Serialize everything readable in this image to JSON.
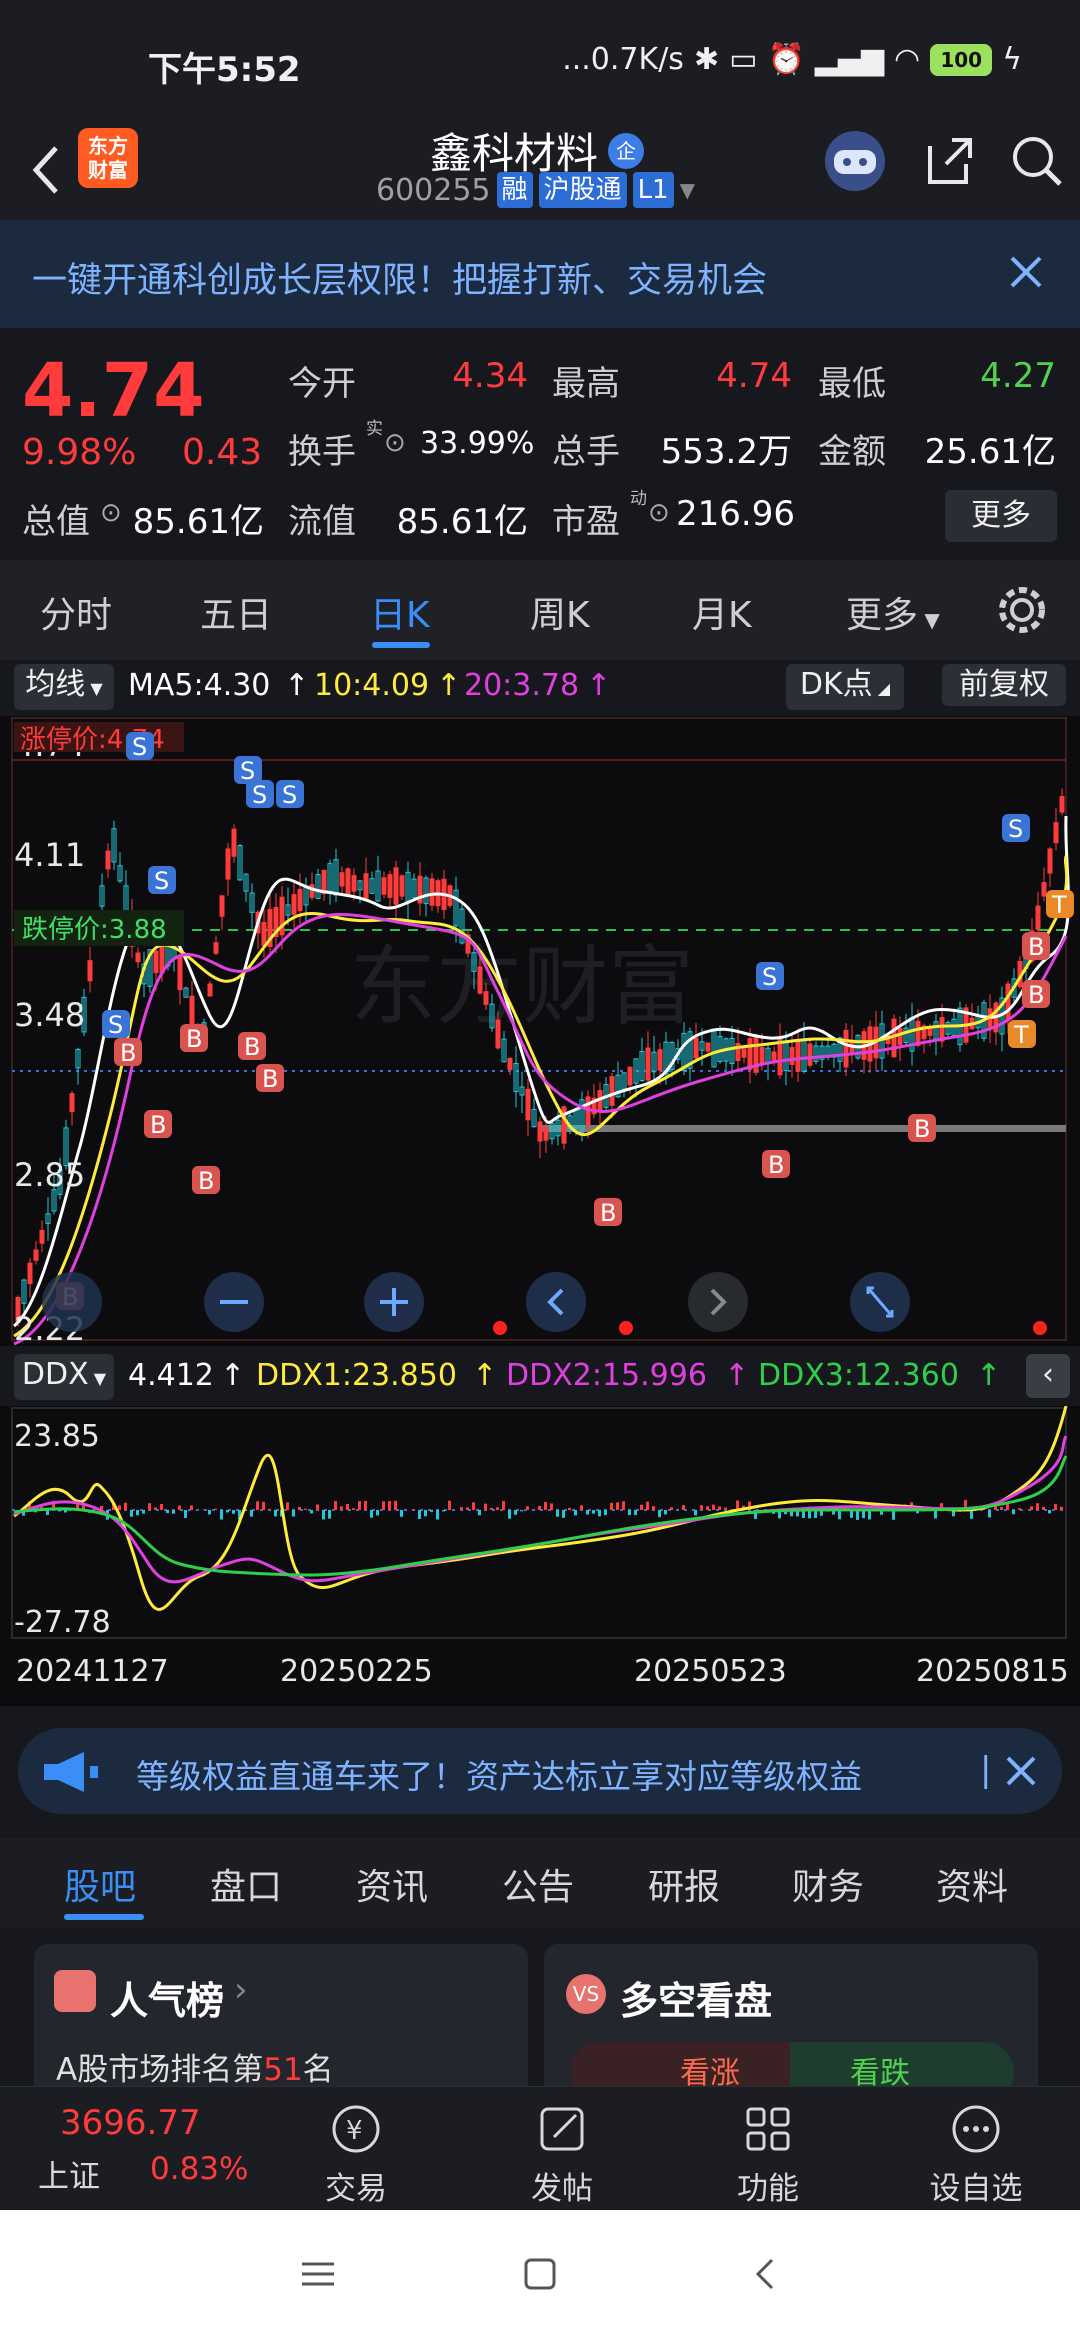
{
  "status": {
    "time": "下午5:52",
    "net": "...0.7K/s",
    "battery": "100"
  },
  "header": {
    "stock_name": "鑫科材料",
    "qi": "企",
    "code": "600255",
    "tags": [
      "融",
      "沪股通",
      "L1"
    ]
  },
  "banner": {
    "text": "一键开通科创成长层权限！把握打新、交易机会"
  },
  "quote": {
    "price": "4.74",
    "pct": "9.98%",
    "chg": "0.43",
    "labels": {
      "open": "今开",
      "high": "最高",
      "low": "最低",
      "turnover": "换手",
      "volume": "总手",
      "amount": "金额",
      "mktcap": "总值",
      "float": "流值",
      "pe": "市盈"
    },
    "values": {
      "open": "4.34",
      "high": "4.74",
      "low": "4.27",
      "turnover": "33.99%",
      "volume": "553.2万",
      "amount": "25.61亿",
      "mktcap": "85.61亿",
      "float": "85.61亿",
      "pe": "216.96"
    },
    "sup_turnover": "实",
    "sup_pe": "动",
    "more": "更多"
  },
  "tabs": [
    "分时",
    "五日",
    "日K",
    "周K",
    "月K",
    "更多"
  ],
  "ma": {
    "selector": "均线",
    "ma5": "MA5:4.30",
    "ma10": "10:4.09",
    "ma20": "20:3.78",
    "dk": "DK点",
    "adjust": "前复权"
  },
  "colors": {
    "up": "#ff3b3b",
    "down": "#20c8d8",
    "ma5": "#ffffff",
    "ma10": "#ffeb3b",
    "ma20": "#e040e0",
    "accent": "#3a8ef6"
  },
  "kchart": {
    "ticks": [
      "4.74",
      "4.11",
      "3.48",
      "2.85",
      "2.22"
    ],
    "limit_up": "涨停价:4.74",
    "limit_down": "跌停价:3.88",
    "watermark": "东方财富",
    "markers_s": [
      "S",
      "S",
      "S",
      "S",
      "S",
      "S",
      "S",
      "S"
    ],
    "markers_b": [
      "B",
      "B",
      "B",
      "B",
      "B",
      "B",
      "B",
      "B",
      "B",
      "B",
      "B",
      "B"
    ],
    "markers_t": [
      "T",
      "T"
    ]
  },
  "ddx": {
    "selector": "DDX",
    "ddx": "4.412",
    "ddx1": "DDX1:23.850",
    "ddx2": "DDX2:15.996",
    "ddx3": "DDX3:12.360",
    "ticks": [
      "23.85",
      "-27.78"
    ]
  },
  "dates": [
    "20241127",
    "20250225",
    "20250523",
    "20250815"
  ],
  "banner2": {
    "text": "等级权益直通车来了！资产达标立享对应等级权益"
  },
  "bottom_tabs": [
    "股吧",
    "盘口",
    "资讯",
    "公告",
    "研报",
    "财务",
    "资料"
  ],
  "cards": {
    "left_title": "人气榜",
    "left_sub_prefix": "A股市场排名第",
    "left_rank": "51",
    "left_sub_suffix": "名",
    "right_title": "多空看盘",
    "bull": "看涨",
    "bear": "看跌"
  },
  "bnav": {
    "index_value": "3696.77",
    "index_name": "上证",
    "index_pct": "0.83%",
    "items": [
      "交易",
      "发帖",
      "功能",
      "设自选"
    ]
  }
}
